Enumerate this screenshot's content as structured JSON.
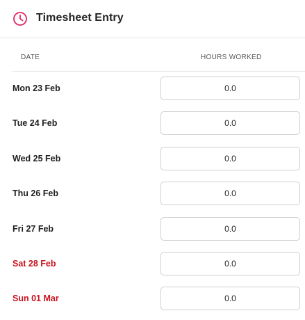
{
  "header": {
    "title": "Timesheet Entry",
    "icon": "clock-icon",
    "accent_color": "#e0245e"
  },
  "table": {
    "columns": [
      "DATE",
      "HOURS WORKED"
    ],
    "rows": [
      {
        "date": "Mon 23 Feb",
        "hours": "0.0",
        "weekend": false
      },
      {
        "date": "Tue 24 Feb",
        "hours": "0.0",
        "weekend": false
      },
      {
        "date": "Wed 25 Feb",
        "hours": "0.0",
        "weekend": false
      },
      {
        "date": "Thu 26 Feb",
        "hours": "0.0",
        "weekend": false
      },
      {
        "date": "Fri 27 Feb",
        "hours": "0.0",
        "weekend": false
      },
      {
        "date": "Sat 28 Feb",
        "hours": "0.0",
        "weekend": true
      },
      {
        "date": "Sun 01 Mar",
        "hours": "0.0",
        "weekend": true
      }
    ],
    "weekend_color": "#c8141e"
  }
}
